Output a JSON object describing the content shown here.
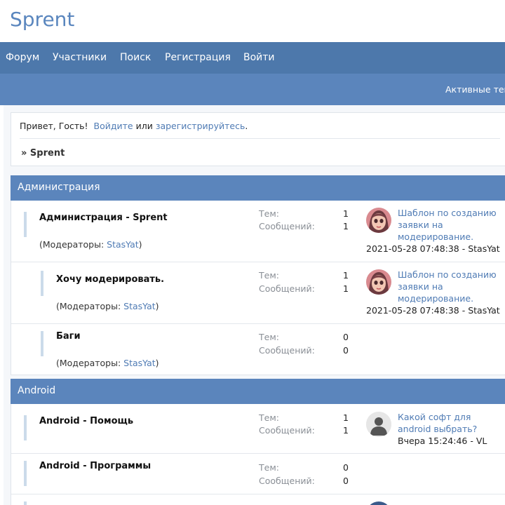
{
  "site": {
    "logo": "Sprent"
  },
  "nav": {
    "items": [
      "Форум",
      "Участники",
      "Поиск",
      "Регистрация",
      "Войти"
    ]
  },
  "subbar": {
    "active_topics": "Активные тем"
  },
  "greeting": {
    "hello": "Привет, Гость!",
    "login": "Войдите",
    "or": "или",
    "register": "зарегистрируйтесь",
    "dot": "."
  },
  "breadcrumb": "» Sprent",
  "labels": {
    "topics": "Тем:",
    "posts": "Сообщений:",
    "moderators_prefix": "(Модераторы: ",
    "moderators_suffix": ")"
  },
  "categories": [
    {
      "title": "Администрация",
      "forums": [
        {
          "name": "Администрация - Sprent",
          "moderator": "StasYat",
          "topics": "1",
          "posts": "1",
          "last_title": "Шаблон по созданию заявки на модерирование.",
          "last_meta": "2021-05-28 07:48:38 - StasYat",
          "avatar": "girl-avatar-icon"
        },
        {
          "name": "Хочу модерировать.",
          "moderator": "StasYat",
          "topics": "1",
          "posts": "1",
          "last_title": "Шаблон по созданию заявки на модерирование.",
          "last_meta": "2021-05-28 07:48:38 - StasYat",
          "avatar": "girl-avatar-icon"
        },
        {
          "name": "Баги",
          "moderator": "StasYat",
          "topics": "0",
          "posts": "0"
        }
      ]
    },
    {
      "title": "Android",
      "forums": [
        {
          "name": "Android - Помощь",
          "topics": "1",
          "posts": "1",
          "last_title": "Какой софт для android выбрать?",
          "last_meta": "Вчера 15:24:46 - VL",
          "avatar": "default-user-avatar-icon"
        },
        {
          "name": "Android - Программы",
          "topics": "0",
          "posts": "0"
        }
      ]
    }
  ],
  "colors": {
    "nav": "#4d78ab",
    "header_bar": "#5b85bc",
    "link": "#4f7bb4",
    "accent_bar": "#cbdbea"
  }
}
